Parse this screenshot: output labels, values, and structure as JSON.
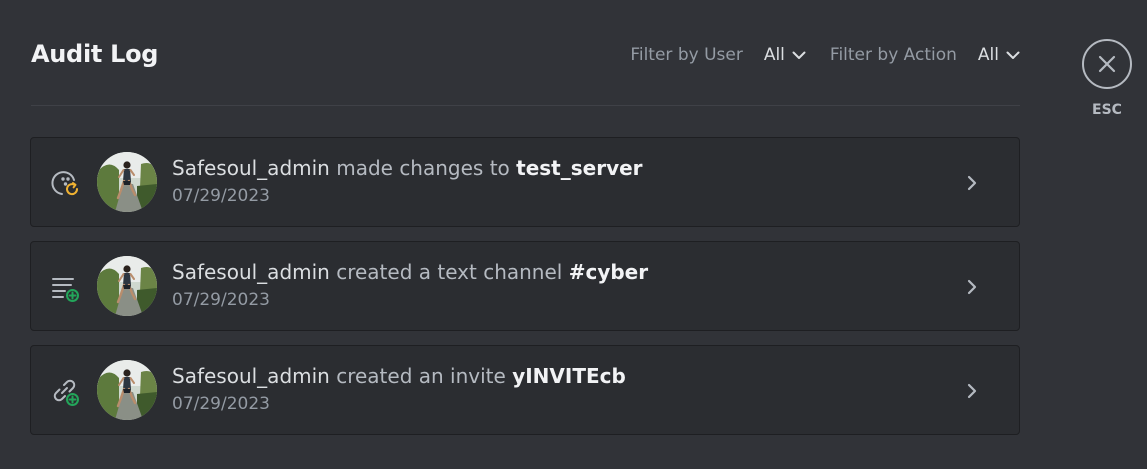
{
  "header": {
    "title": "Audit Log",
    "filter_user_label": "Filter by User",
    "filter_user_value": "All",
    "filter_action_label": "Filter by Action",
    "filter_action_value": "All"
  },
  "esc": {
    "label": "ESC"
  },
  "entries": [
    {
      "icon": "server-update-icon",
      "user": "Safesoul_admin",
      "action": "made changes to",
      "target": "test_server",
      "date": "07/29/2023"
    },
    {
      "icon": "channel-create-icon",
      "user": "Safesoul_admin",
      "action": "created a text channel",
      "target": "#cyber",
      "date": "07/29/2023"
    },
    {
      "icon": "invite-create-icon",
      "user": "Safesoul_admin",
      "action": "created an invite",
      "target": "yINVITEcb",
      "date": "07/29/2023"
    }
  ],
  "colors": {
    "background": "#313338",
    "entry_background": "#2b2d31",
    "update_accent": "#f0b232",
    "create_accent": "#23a55a"
  }
}
